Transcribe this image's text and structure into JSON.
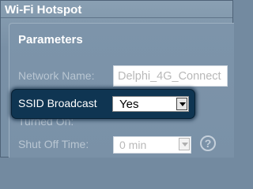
{
  "header": {
    "title": "Wi-Fi Hotspot"
  },
  "parameters": {
    "title": "Parameters",
    "network_name": {
      "label": "Network Name:",
      "value": "Delphi_4G_Connect"
    },
    "ssid_broadcast": {
      "label": "SSID Broadcast",
      "value": "Yes",
      "icon": "chevron-down-icon"
    },
    "turned_on": {
      "label": "Turned On:"
    },
    "shut_off_time": {
      "label": "Shut Off Time:",
      "value": "0 min",
      "icon": "chevron-down-icon"
    },
    "help": {
      "glyph": "?",
      "icon": "help-icon"
    }
  },
  "colors": {
    "background": "#7890a6",
    "highlight": "#0f3552",
    "label": "#b9c6d2",
    "title": "#ffffff"
  }
}
